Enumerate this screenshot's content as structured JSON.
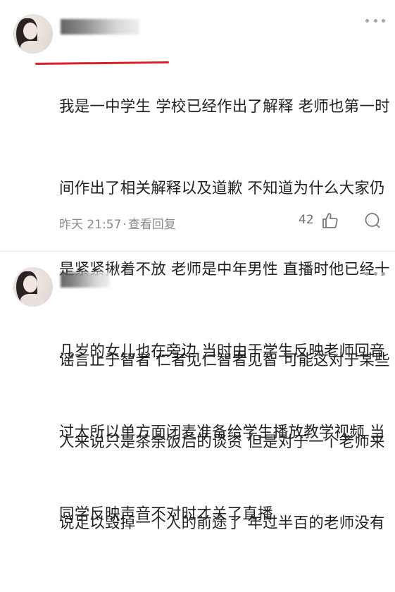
{
  "comments": [
    {
      "username": "",
      "text_lines": [
        "我是一中学生 学校已经作出了解释 老师也第一时",
        "间作出了相关解释以及道歉 不知道为什么大家仍",
        "是紧紧揪着不放 老师是中年男性 直播时他已经十",
        "几岁的女儿也在旁边 当时由于学生反映老师回音",
        "过大所以单方面闭麦准备给学生播放教学视频 当",
        "同学反映声音不对时才关了直播"
      ],
      "time": "昨天 21:57",
      "separator": "·",
      "reply_label": "查看回复",
      "likes": "42",
      "underline_color": "#d8232a"
    },
    {
      "username": "",
      "text_lines": [
        "谣言止于智者 仁者见仁智者见智 可能这对于某些",
        "人来说只是茶余饭后的谈资 但是对于一个老师来",
        "说足以毁掉一个人的前途了 年过半百的老师没有"
      ]
    }
  ],
  "icons": {
    "more": "more-dots-icon",
    "like": "thumbs-up-icon",
    "comment": "comment-bubble-icon"
  }
}
